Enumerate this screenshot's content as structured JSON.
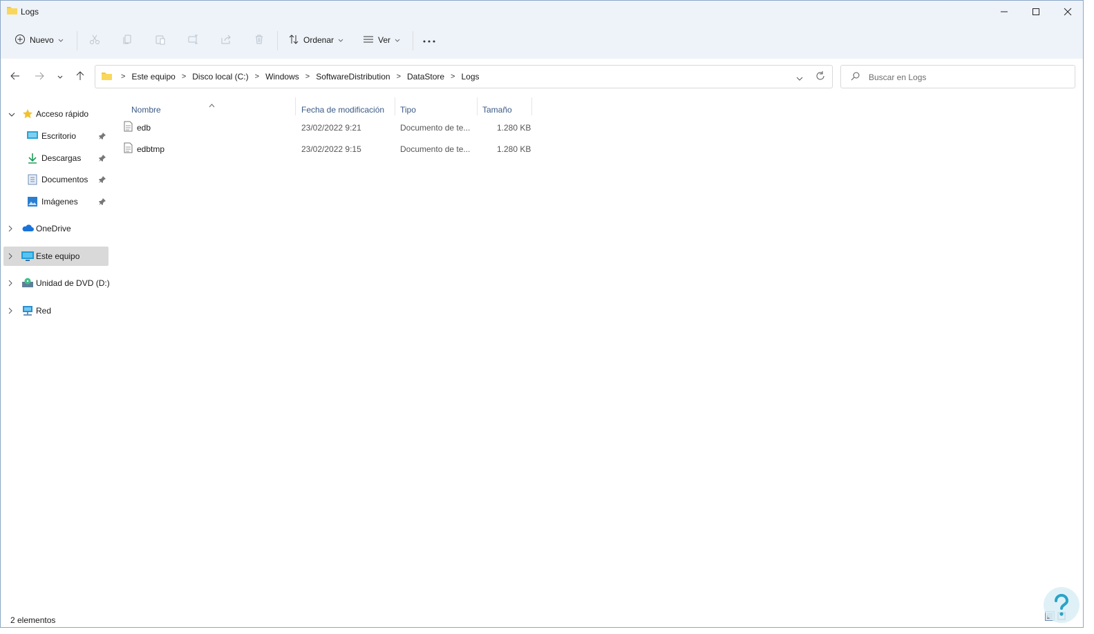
{
  "window": {
    "title": "Logs",
    "controls": [
      "minimize",
      "maximize",
      "close"
    ]
  },
  "toolbar": {
    "new_label": "Nuevo",
    "sort_label": "Ordenar",
    "view_label": "Ver",
    "icons": [
      "cut-icon",
      "copy-icon",
      "paste-icon",
      "rename-icon",
      "share-icon",
      "delete-icon",
      "more-icon"
    ]
  },
  "address": {
    "crumbs": [
      "Este equipo",
      "Disco local (C:)",
      "Windows",
      "SoftwareDistribution",
      "DataStore",
      "Logs"
    ]
  },
  "search": {
    "placeholder": "Buscar en Logs"
  },
  "sidebar": {
    "quick_access": "Acceso rápido",
    "items": [
      {
        "label": "Escritorio",
        "icon": "desktop-icon"
      },
      {
        "label": "Descargas",
        "icon": "download-icon"
      },
      {
        "label": "Documentos",
        "icon": "documents-icon"
      },
      {
        "label": "Imágenes",
        "icon": "pictures-icon"
      }
    ],
    "onedrive": "OneDrive",
    "this_pc": "Este equipo",
    "dvd": "Unidad de DVD (D:)",
    "network": "Red"
  },
  "columns": {
    "name": "Nombre",
    "modified": "Fecha de modificación",
    "type": "Tipo",
    "size": "Tamaño"
  },
  "files": [
    {
      "name": "edb",
      "modified": "23/02/2022 9:21",
      "type": "Documento de te...",
      "size": "1.280 KB"
    },
    {
      "name": "edbtmp",
      "modified": "23/02/2022 9:15",
      "type": "Documento de te...",
      "size": "1.280 KB"
    }
  ],
  "status": {
    "count": "2 elementos"
  },
  "colors": {
    "chrome_bg": "#eef3f9",
    "selected_bg": "#d9d9d9",
    "header_text": "#3a5a86",
    "folder_yellow": "#f4c542"
  }
}
